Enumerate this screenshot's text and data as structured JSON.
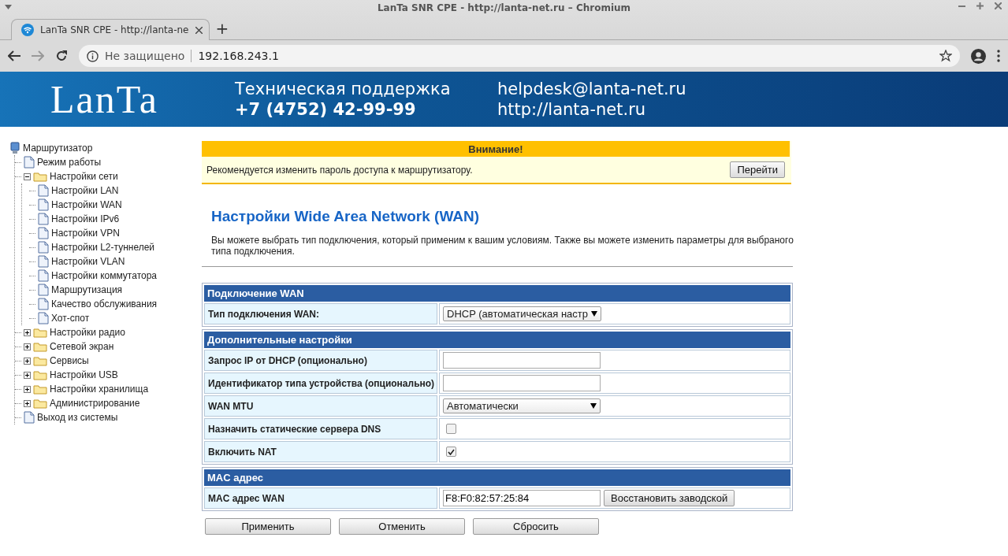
{
  "window": {
    "title": "LanTa SNR CPE - http://lanta-net.ru – Chromium"
  },
  "tabs": [
    {
      "label": "LanTa SNR CPE - http://lanta-ne",
      "selected": true
    }
  ],
  "new_tab": "+",
  "address_bar": {
    "security": "Не защищено",
    "url": "192.168.243.1"
  },
  "banner": {
    "logo": "LanTa",
    "support_title": "Техническая поддержка",
    "phone": "+7 (4752) 42-99-99",
    "email": "helpdesk@lanta-net.ru",
    "site": "http://lanta-net.ru"
  },
  "sidebar": {
    "root": "Маршрутизатор",
    "items": [
      {
        "label": "Режим работы",
        "kind": "page"
      },
      {
        "label": "Настройки сети",
        "kind": "folder",
        "expanded": true,
        "children": [
          {
            "label": "Настройки LAN",
            "kind": "page"
          },
          {
            "label": "Настройки WAN",
            "kind": "page"
          },
          {
            "label": "Настройки IPv6",
            "kind": "page"
          },
          {
            "label": "Настройки VPN",
            "kind": "page"
          },
          {
            "label": "Настройки L2-туннелей",
            "kind": "page"
          },
          {
            "label": "Настройки VLAN",
            "kind": "page"
          },
          {
            "label": "Настройки коммутатора",
            "kind": "page"
          },
          {
            "label": "Маршрутизация",
            "kind": "page"
          },
          {
            "label": "Качество обслуживания",
            "kind": "page"
          },
          {
            "label": "Хот-спот",
            "kind": "page"
          }
        ]
      },
      {
        "label": "Настройки радио",
        "kind": "folder",
        "expanded": false
      },
      {
        "label": "Сетевой экран",
        "kind": "folder",
        "expanded": false
      },
      {
        "label": "Сервисы",
        "kind": "folder",
        "expanded": false
      },
      {
        "label": "Настройки USB",
        "kind": "folder",
        "expanded": false
      },
      {
        "label": "Настройки хранилища",
        "kind": "folder",
        "expanded": false
      },
      {
        "label": "Администрирование",
        "kind": "folder",
        "expanded": false
      },
      {
        "label": "Выход из системы",
        "kind": "page"
      }
    ]
  },
  "alert": {
    "title": "Внимание!",
    "message": "Рекомендуется изменить пароль доступа к маршрутизатору.",
    "button": "Перейти"
  },
  "page_title": "Настройки Wide Area Network (WAN)",
  "description": "Вы можете выбрать тип подключения, который применим к вашим условиям. Также вы можете изменить параметры для выбраного типа подключения.",
  "sections": [
    {
      "title": "Подключение WAN",
      "rows": [
        {
          "label": "Тип подключения WAN:",
          "kind": "select",
          "value": "DHCP (автоматическая настр"
        }
      ]
    },
    {
      "title": "Дополнительные настройки",
      "rows": [
        {
          "label": "Запрос IP от DHCP (опционально)",
          "kind": "text"
        },
        {
          "label": "Идентификатор типа устройства (опционально)",
          "kind": "text"
        },
        {
          "label": "WAN MTU",
          "kind": "select",
          "value": "Автоматически"
        },
        {
          "label": "Назначить статические сервера DNS",
          "kind": "checkbox",
          "checked": false
        },
        {
          "label": "Включить NAT",
          "kind": "checkbox",
          "checked": true
        }
      ]
    },
    {
      "title": "MAC адрес",
      "rows": [
        {
          "label": "MAC адрес WAN",
          "kind": "mac",
          "value": "F8:F0:82:57:25:84",
          "button": "Восстановить заводской"
        }
      ]
    }
  ],
  "actions": [
    "Применить",
    "Отменить",
    "Сбросить"
  ]
}
